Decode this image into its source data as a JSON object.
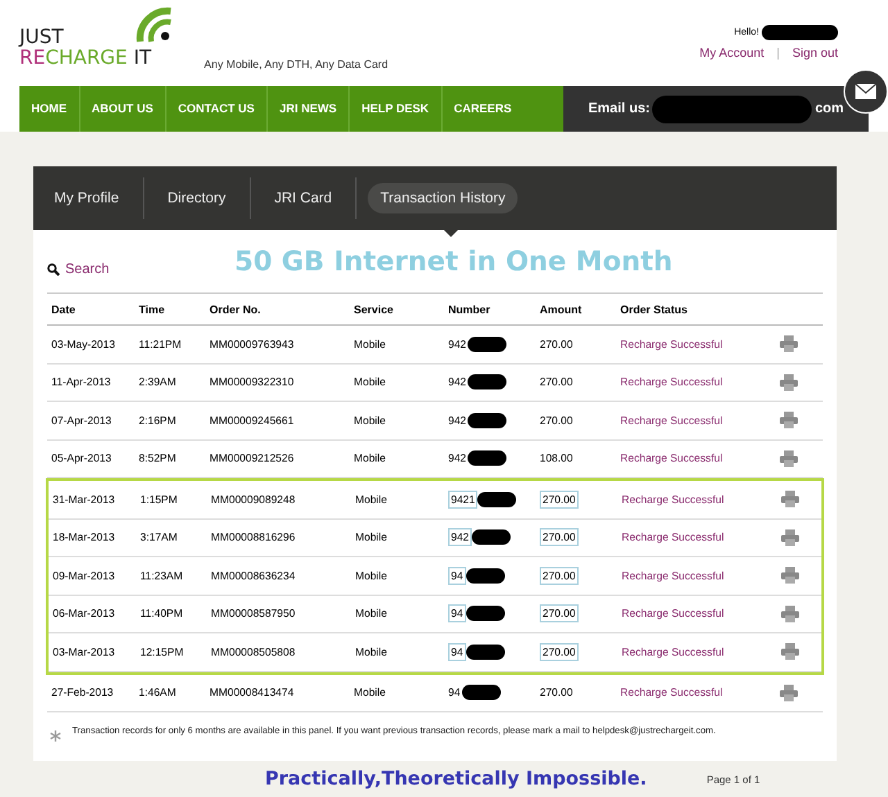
{
  "logo": {
    "top": "JUST",
    "parts": [
      {
        "text": "RE",
        "color": "#b0307a"
      },
      {
        "text": "CHARGE",
        "color": "#6aaa2a"
      },
      {
        "text": "IT",
        "color": "#222222"
      }
    ]
  },
  "tagline": "Any Mobile, Any DTH, Any Data Card",
  "user": {
    "greeting": "Hello!",
    "links": [
      "My Account",
      "Sign out"
    ],
    "separator": "|"
  },
  "nav": {
    "items": [
      "HOME",
      "ABOUT US",
      "CONTACT US",
      "JRI NEWS",
      "HELP DESK",
      "CAREERS"
    ],
    "email_label": "Email us:",
    "email_tail": "com"
  },
  "tabs": [
    {
      "label": "My Profile",
      "selected": false
    },
    {
      "label": "Directory",
      "selected": false
    },
    {
      "label": "JRI Card",
      "selected": false
    },
    {
      "label": "Transaction History",
      "selected": true
    }
  ],
  "search": "Search",
  "headline": "50 GB Internet in One Month",
  "table": {
    "columns": [
      "Date",
      "Time",
      "Order No.",
      "Service",
      "Number",
      "Amount",
      "Order Status"
    ],
    "rows": [
      {
        "date": "03-May-2013",
        "time": "11:21PM",
        "order": "MM00009763943",
        "service": "Mobile",
        "number": "942",
        "amount": "270.00",
        "status": "Recharge Successful",
        "highlighted": false
      },
      {
        "date": "11-Apr-2013",
        "time": "2:39AM",
        "order": "MM00009322310",
        "service": "Mobile",
        "number": "942",
        "amount": "270.00",
        "status": "Recharge Successful",
        "highlighted": false
      },
      {
        "date": "07-Apr-2013",
        "time": "2:16PM",
        "order": "MM00009245661",
        "service": "Mobile",
        "number": "942",
        "amount": "270.00",
        "status": "Recharge Successful",
        "highlighted": false
      },
      {
        "date": "05-Apr-2013",
        "time": "8:52PM",
        "order": "MM00009212526",
        "service": "Mobile",
        "number": "942",
        "amount": "108.00",
        "status": "Recharge Successful",
        "highlighted": false
      },
      {
        "date": "31-Mar-2013",
        "time": "1:15PM",
        "order": "MM00009089248",
        "service": "Mobile",
        "number": "9421",
        "amount": "270.00",
        "status": "Recharge Successful",
        "highlighted": true
      },
      {
        "date": "18-Mar-2013",
        "time": "3:17AM",
        "order": "MM00008816296",
        "service": "Mobile",
        "number": "942",
        "amount": "270.00",
        "status": "Recharge Successful",
        "highlighted": true
      },
      {
        "date": "09-Mar-2013",
        "time": "11:23AM",
        "order": "MM00008636234",
        "service": "Mobile",
        "number": "94",
        "amount": "270.00",
        "status": "Recharge Successful",
        "highlighted": true
      },
      {
        "date": "06-Mar-2013",
        "time": "11:40PM",
        "order": "MM00008587950",
        "service": "Mobile",
        "number": "94",
        "amount": "270.00",
        "status": "Recharge Successful",
        "highlighted": true
      },
      {
        "date": "03-Mar-2013",
        "time": "12:15PM",
        "order": "MM00008505808",
        "service": "Mobile",
        "number": "94",
        "amount": "270.00",
        "status": "Recharge Successful",
        "highlighted": true
      },
      {
        "date": "27-Feb-2013",
        "time": "1:46AM",
        "order": "MM00008413474",
        "service": "Mobile",
        "number": "94",
        "amount": "270.00",
        "status": "Recharge Successful",
        "highlighted": false
      }
    ]
  },
  "note": "Transaction records for only 6 months are available in this panel. If you want previous transaction records, please mark a mail to helpdesk@justrechargeit.com.",
  "caption": "Practically,Theoretically Impossible.",
  "pagination": "Page 1 of 1"
}
